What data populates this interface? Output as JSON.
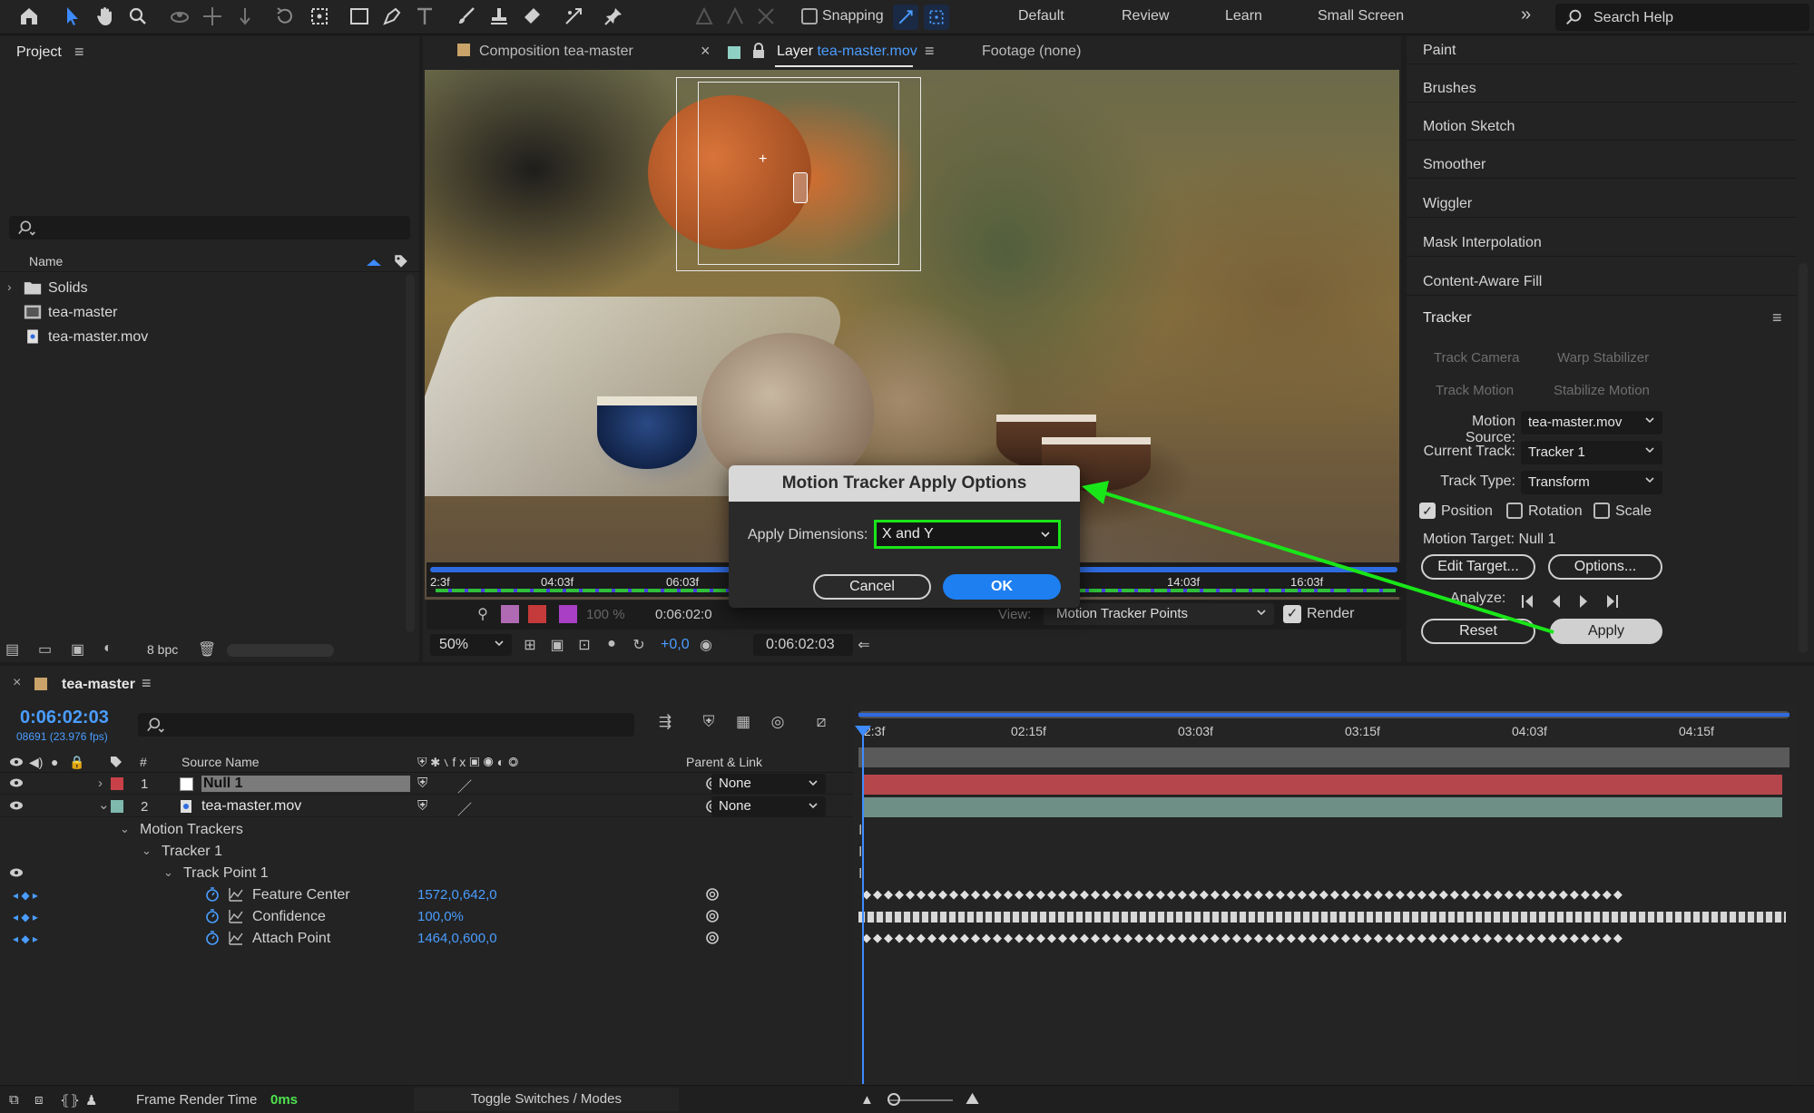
{
  "toolbar": {
    "snapping_label": "Snapping",
    "workspaces": [
      "Default",
      "Review",
      "Learn",
      "Small Screen"
    ],
    "search_placeholder": "Search Help"
  },
  "project": {
    "title": "Project",
    "column_name": "Name",
    "items": [
      {
        "label": "Solids",
        "icon": "folder-icon"
      },
      {
        "label": "tea-master",
        "icon": "composition-icon"
      },
      {
        "label": "tea-master.mov",
        "icon": "footage-icon"
      }
    ],
    "bit_depth": "8 bpc"
  },
  "viewer": {
    "tabs": [
      {
        "label": "Composition tea-master"
      },
      {
        "prefix": "Layer",
        "name": "tea-master.mov"
      },
      {
        "label": "Footage (none)"
      }
    ],
    "mini_ticks": [
      "2:3f",
      "04:03f",
      "06:03f",
      "14:03f",
      "16:03f"
    ],
    "progress_percent": "100 %",
    "current_time_short": "0:06:02:0",
    "view_label": "View:",
    "view_value": "Motion Tracker Points",
    "render_label": "Render",
    "zoom": "50%",
    "exposure": "+0,0",
    "timecode": "0:06:02:03"
  },
  "right_panel": {
    "items": [
      "Paint",
      "Brushes",
      "Motion Sketch",
      "Smoother",
      "Wiggler",
      "Mask Interpolation",
      "Content-Aware Fill"
    ],
    "tracker": {
      "title": "Tracker",
      "track_camera": "Track Camera",
      "warp_stabilizer": "Warp Stabilizer",
      "track_motion": "Track Motion",
      "stabilize_motion": "Stabilize Motion",
      "motion_source_label": "Motion Source:",
      "motion_source": "tea-master.mov",
      "current_track_label": "Current Track:",
      "current_track": "Tracker 1",
      "track_type_label": "Track Type:",
      "track_type": "Transform",
      "position_label": "Position",
      "rotation_label": "Rotation",
      "scale_label": "Scale",
      "motion_target": "Motion Target: Null 1",
      "edit_target": "Edit Target...",
      "options": "Options...",
      "analyze_label": "Analyze:",
      "reset": "Reset",
      "apply": "Apply"
    }
  },
  "dialog": {
    "title": "Motion Tracker Apply Options",
    "apply_dimensions_label": "Apply Dimensions:",
    "apply_dimensions_value": "X and Y",
    "cancel": "Cancel",
    "ok": "OK"
  },
  "timeline": {
    "comp_name": "tea-master",
    "timecode": "0:06:02:03",
    "frame_info": "08691 (23.976 fps)",
    "col_hash": "#",
    "col_source": "Source Name",
    "col_parent": "Parent & Link",
    "ruler_ticks": [
      "2:3f",
      "02:15f",
      "03:03f",
      "03:15f",
      "04:03f",
      "04:15f"
    ],
    "layers": [
      {
        "num": "1",
        "name": "Null 1",
        "parent": "None",
        "label_color": "#c94148"
      },
      {
        "num": "2",
        "name": "tea-master.mov",
        "parent": "None",
        "label_color": "#7fb8ad"
      }
    ],
    "groups": {
      "motion_trackers": "Motion Trackers",
      "tracker1": "Tracker 1",
      "track_point1": "Track Point 1"
    },
    "properties": [
      {
        "name": "Feature Center",
        "value": "1572,0,642,0"
      },
      {
        "name": "Confidence",
        "value": "100,0%"
      },
      {
        "name": "Attach Point",
        "value": "1464,0,600,0"
      }
    ]
  },
  "status": {
    "frame_render_label": "Frame Render Time",
    "frame_render_value": "0ms",
    "toggle": "Toggle Switches / Modes"
  },
  "colors": {
    "accent_blue": "#3d8bff",
    "highlight_green": "#19e619",
    "null_bar": "#b5474c",
    "footage_bar": "#6e8f86"
  }
}
